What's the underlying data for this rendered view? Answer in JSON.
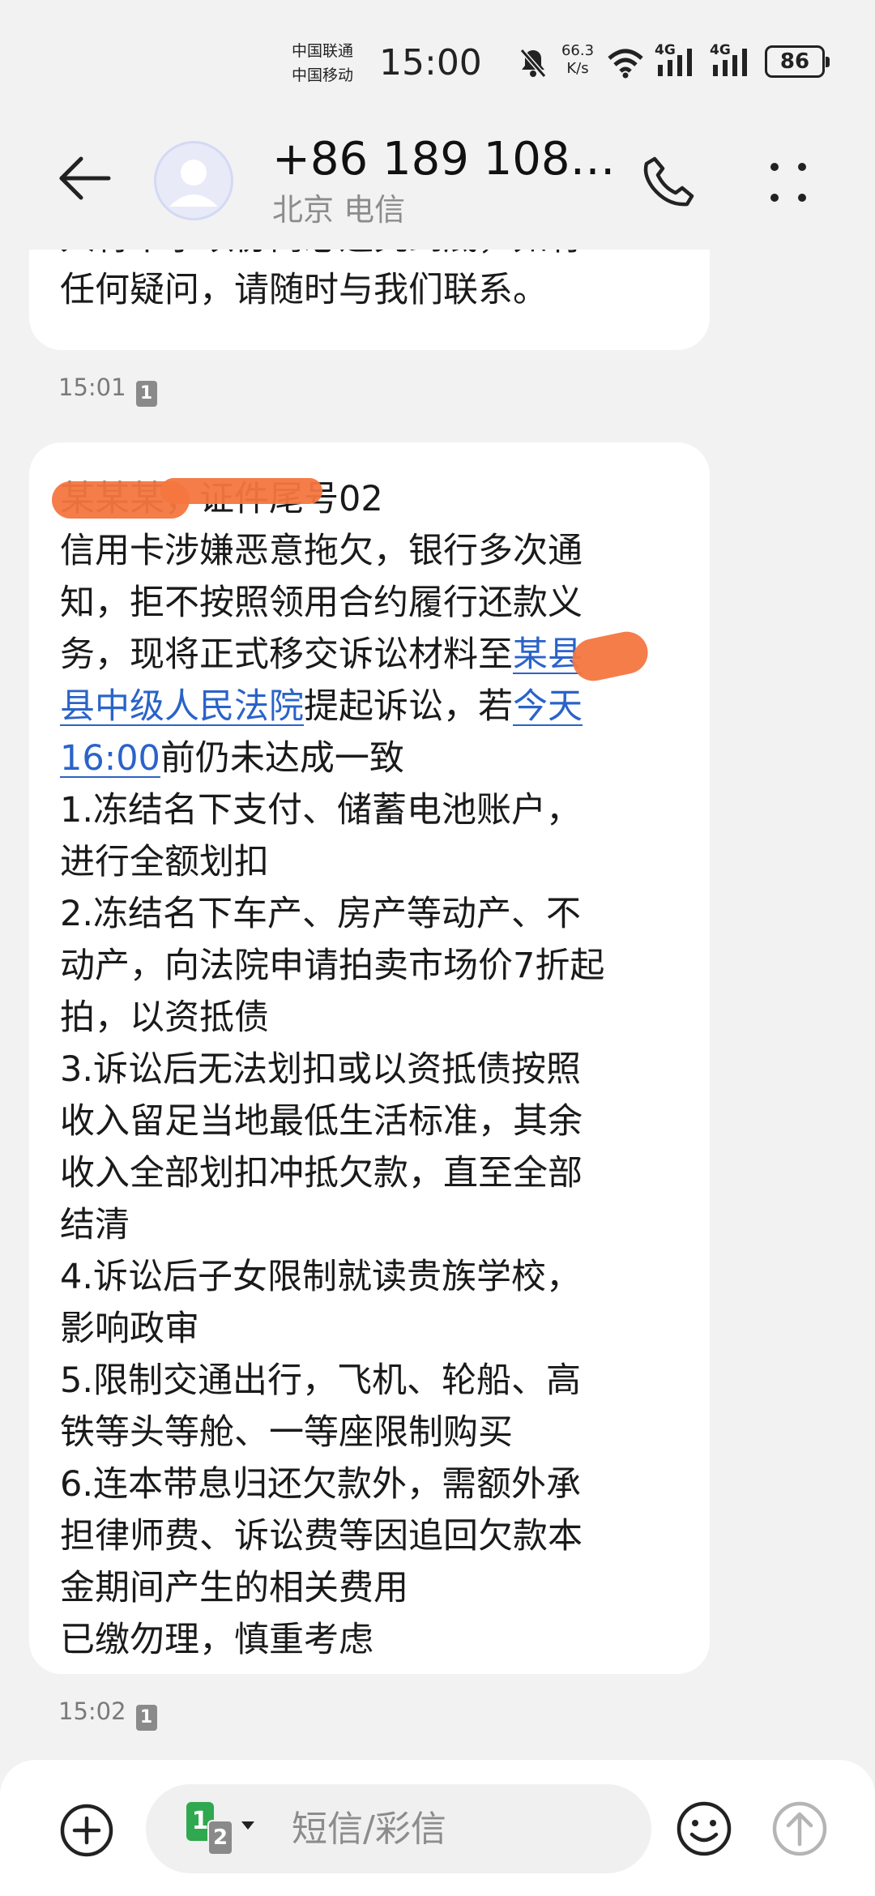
{
  "status_bar": {
    "carrier_1": "中国联通",
    "carrier_2": "中国移动",
    "time": "15:00",
    "net_speed_value": "66.3",
    "net_speed_unit": "K/s",
    "network_1": "4G",
    "network_2": "4G",
    "battery": "86"
  },
  "header": {
    "contact_name": "+86 189 108…",
    "contact_location": "北京 电信",
    "back_icon": "back-arrow-icon",
    "call_icon": "phone-icon",
    "more_icon": "more-icon"
  },
  "messages": [
    {
      "lines": [
        "入将不予以协商必追究到底，如有",
        "任何疑问，请随时与我们联系。"
      ],
      "time": "15:01",
      "sim": "1"
    },
    {
      "lines_head": [
        "某某某，证件尾号02"
      ],
      "line_3": "信用卡涉嫌恶意拖欠，银行多次通",
      "line_4": "知，拒不按照领用合约履行还款义",
      "line_5_pre": "务，现将正式移交诉讼材料至",
      "line_5_link": "某县",
      "line_6_link": "县中级人民法院",
      "line_6_mid": "提起诉讼，若",
      "line_6_link2": "今天",
      "line_7_link": "16:00",
      "line_7_post": "前仍未达成一致",
      "body_lines": [
        "1.冻结名下支付、储蓄电池账户，",
        "进行全额划扣",
        "2.冻结名下车产、房产等动产、不",
        "动产，向法院申请拍卖市场价7折起",
        "拍，以资抵债",
        "3.诉讼后无法划扣或以资抵债按照",
        "收入留足当地最低生活标准，其余",
        "收入全部划扣冲抵欠款，直至全部",
        "结清",
        "4.诉讼后子女限制就读贵族学校，",
        "影响政审",
        "5.限制交通出行，飞机、轮船、高",
        "铁等头等舱、一等座限制购买",
        "6.连本带息归还欠款外，需额外承",
        "担律师费、诉讼费等因追回欠款本",
        "金期间产生的相关费用",
        "已缴勿理，慎重考虑"
      ],
      "time": "15:02",
      "sim": "1"
    }
  ],
  "composer": {
    "placeholder": "短信/彩信",
    "sim_primary": "1",
    "sim_secondary": "2",
    "attach_icon": "add-circle-icon",
    "emoji_icon": "emoji-icon",
    "send_icon": "send-icon"
  },
  "colors": {
    "background": "#f2f2f2",
    "bubble": "#ffffff",
    "link": "#2a63c9",
    "redaction": "#f4763f",
    "sim_primary": "#2fa84f"
  }
}
